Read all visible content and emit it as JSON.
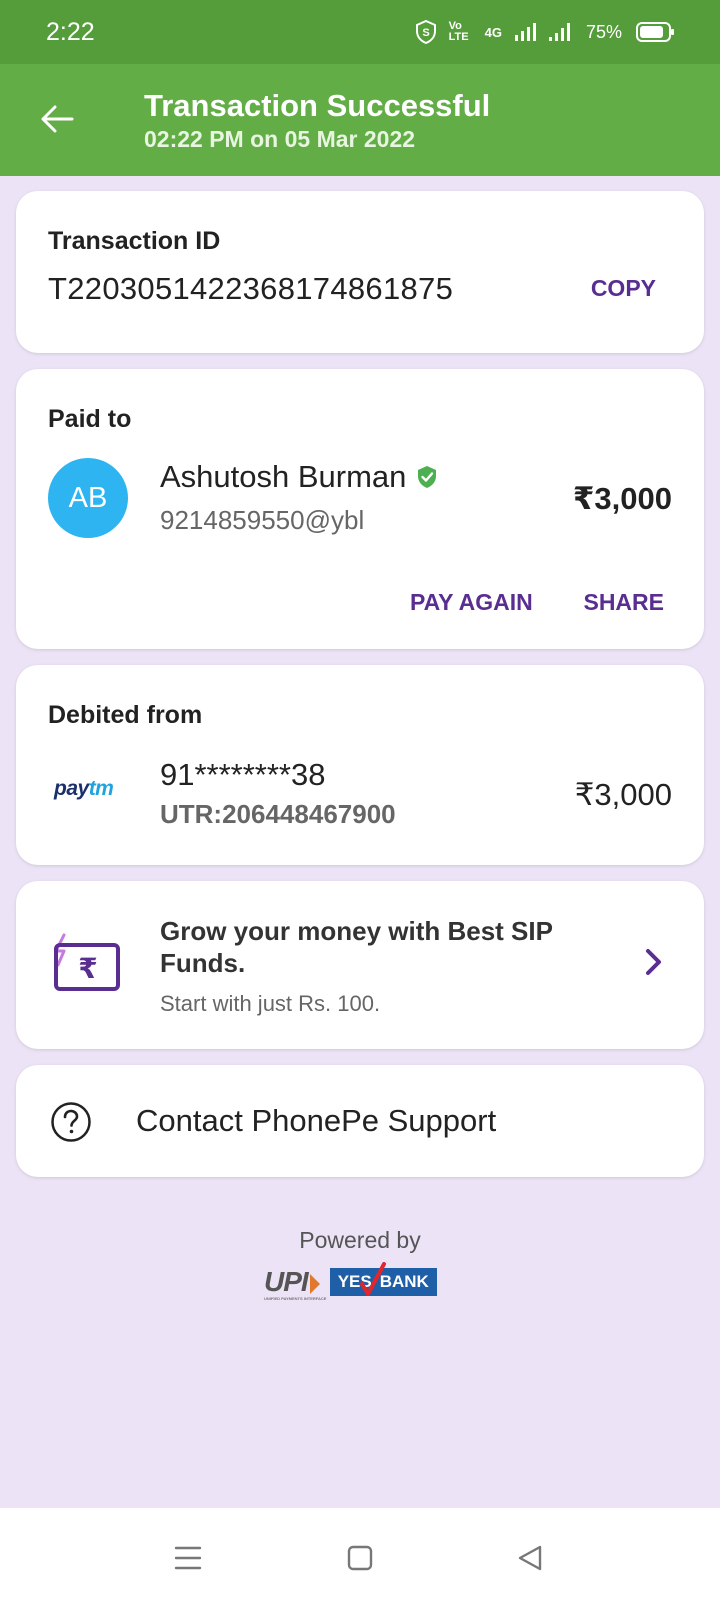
{
  "status_bar": {
    "time": "2:22",
    "network_1": "Vo LTE",
    "network_2": "4G",
    "battery": "75%"
  },
  "header": {
    "title": "Transaction Successful",
    "subtitle": "02:22 PM on 05 Mar 2022"
  },
  "transaction": {
    "label": "Transaction ID",
    "id": "T2203051422368174861875",
    "copy_label": "COPY"
  },
  "paid_to": {
    "label": "Paid to",
    "avatar_initials": "AB",
    "name": "Ashutosh Burman",
    "upi_id": "9214859550@ybl",
    "amount": "₹3,000",
    "pay_again_label": "PAY AGAIN",
    "share_label": "SHARE"
  },
  "debited_from": {
    "label": "Debited from",
    "logo_pay": "pay",
    "logo_tm": "tm",
    "account": "91********38",
    "utr": "UTR:206448467900",
    "amount": "₹3,000"
  },
  "promo": {
    "title": "Grow your money with Best SIP Funds.",
    "subtitle": "Start with just Rs. 100."
  },
  "support": {
    "label": "Contact PhonePe Support"
  },
  "footer": {
    "powered_by": "Powered by",
    "upi_logo": "UPI",
    "upi_tagline": "UNIFIED PAYMENTS INTERFACE",
    "bank_yes": "YES",
    "bank_name": "BANK"
  },
  "colors": {
    "status_bar": "#559c3a",
    "header": "#63ad47",
    "accent": "#5a2d91",
    "avatar": "#2eb4f0",
    "background": "#ece3f6"
  },
  "icons": {
    "back": "arrow-left-icon",
    "verified": "verified-shield-icon",
    "promo": "rupee-card-icon",
    "chevron": "chevron-right-icon",
    "support": "help-circle-icon"
  }
}
